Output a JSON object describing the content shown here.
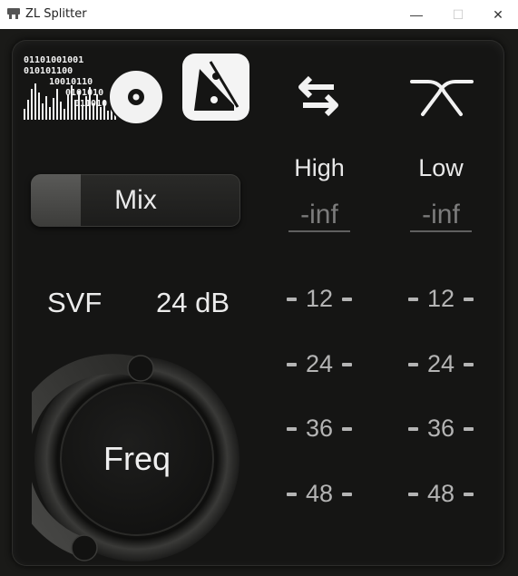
{
  "window": {
    "title": "ZL Splitter",
    "minimize_glyph": "—",
    "maximize_glyph": "☐",
    "close_glyph": "✕"
  },
  "logo": {
    "binary_rows": [
      "01101001001",
      "010101100",
      "10010110",
      "0101010",
      "011010"
    ]
  },
  "toolbar": {
    "mode_icon": "lr-ms-split-icon",
    "swap_icon": "swap-arrows-icon",
    "crossover_icon": "crossover-icon"
  },
  "mix": {
    "label": "Mix",
    "value": 0.24
  },
  "filter": {
    "type": "SVF",
    "slope": "24 dB"
  },
  "knob": {
    "label": "Freq"
  },
  "meters": {
    "high": {
      "label": "High",
      "peak": "-inf"
    },
    "low": {
      "label": "Low",
      "peak": "-inf"
    },
    "scale": [
      "12",
      "24",
      "36",
      "48"
    ]
  },
  "colors": {
    "background": "#1a1a18",
    "text": "#e8e8e8",
    "scale_text": "#b4b4b4",
    "inactive_text": "#7c7c7c"
  }
}
